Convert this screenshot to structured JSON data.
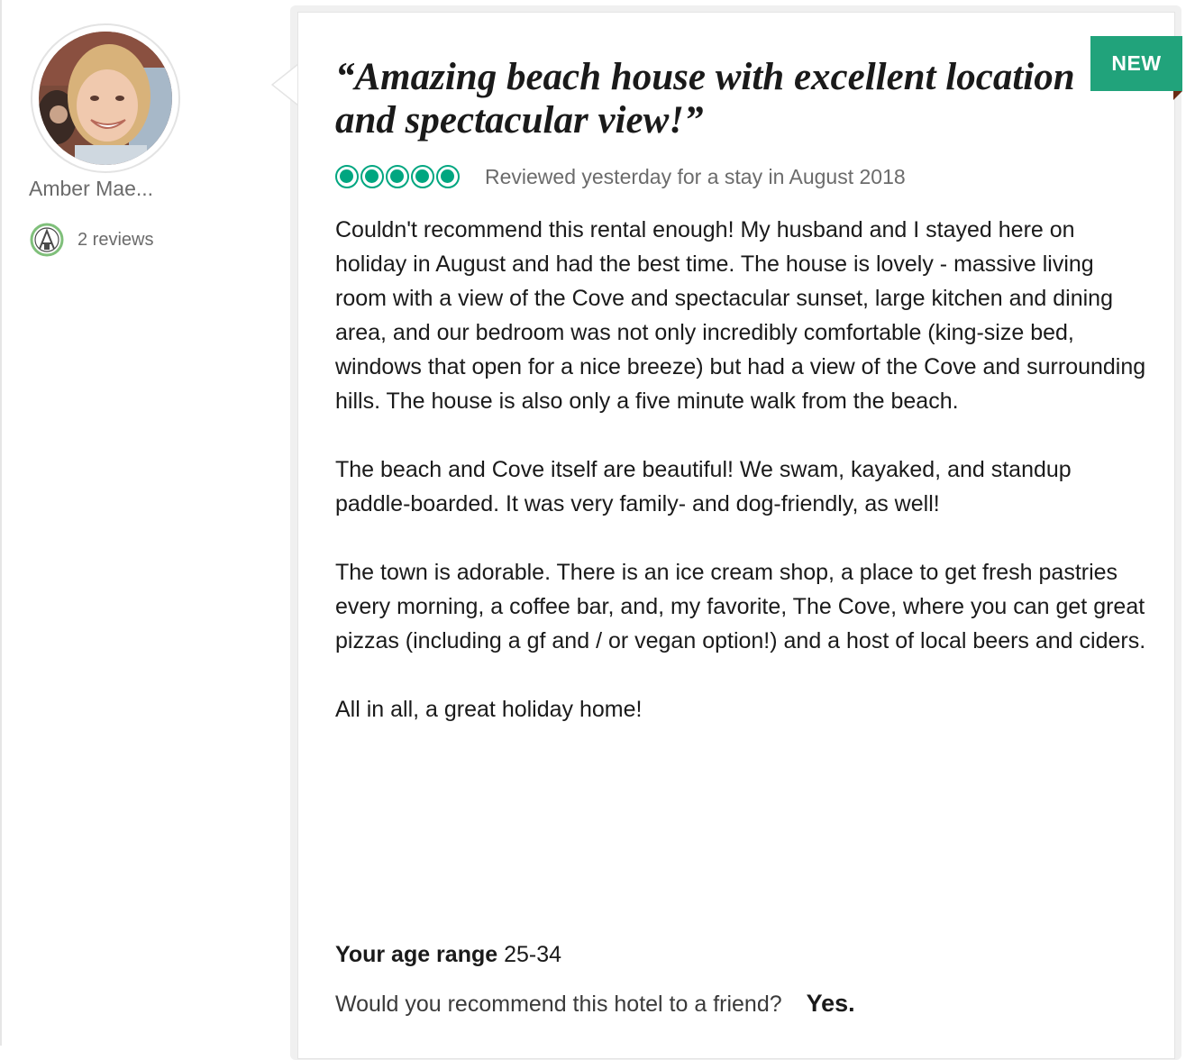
{
  "reviewer": {
    "name": "Amber Mae...",
    "reviews_count": "2 reviews",
    "badge_icon": "contributor-badge-icon"
  },
  "review": {
    "badge": "NEW",
    "title": "“Amazing beach house with excellent location and spectacular view!”",
    "rating": 5,
    "rating_max": 5,
    "date_text": "Reviewed yesterday for a stay in August 2018",
    "paragraphs": [
      "Couldn't recommend this rental enough! My husband and I stayed here on holiday in August and had the best time. The house is lovely - massive living room with a view of the Cove and spectacular sunset, large kitchen and dining area, and our bedroom was not only incredibly comfortable (king-size bed, windows that open for a nice breeze) but had a view of the Cove and surrounding hills. The house is also only a five minute walk from the beach.",
      "The beach and Cove itself are beautiful! We swam, kayaked, and standup paddle-boarded. It was very family- and dog-friendly, as well!",
      "The town is adorable. There is an ice cream shop, a place to get fresh pastries every morning, a coffee bar, and, my favorite, The Cove, where you can get great pizzas (including a gf and / or vegan option!) and a host of local beers and ciders.",
      "All in all, a great holiday home!"
    ],
    "age_range_label": "Your age range",
    "age_range_value": "25-34",
    "recommend_question": "Would you recommend this hotel to a friend?",
    "recommend_answer": "Yes."
  },
  "colors": {
    "accent_green": "#00a680",
    "ribbon_green": "#21a37b",
    "muted_text": "#6b6b6b"
  }
}
